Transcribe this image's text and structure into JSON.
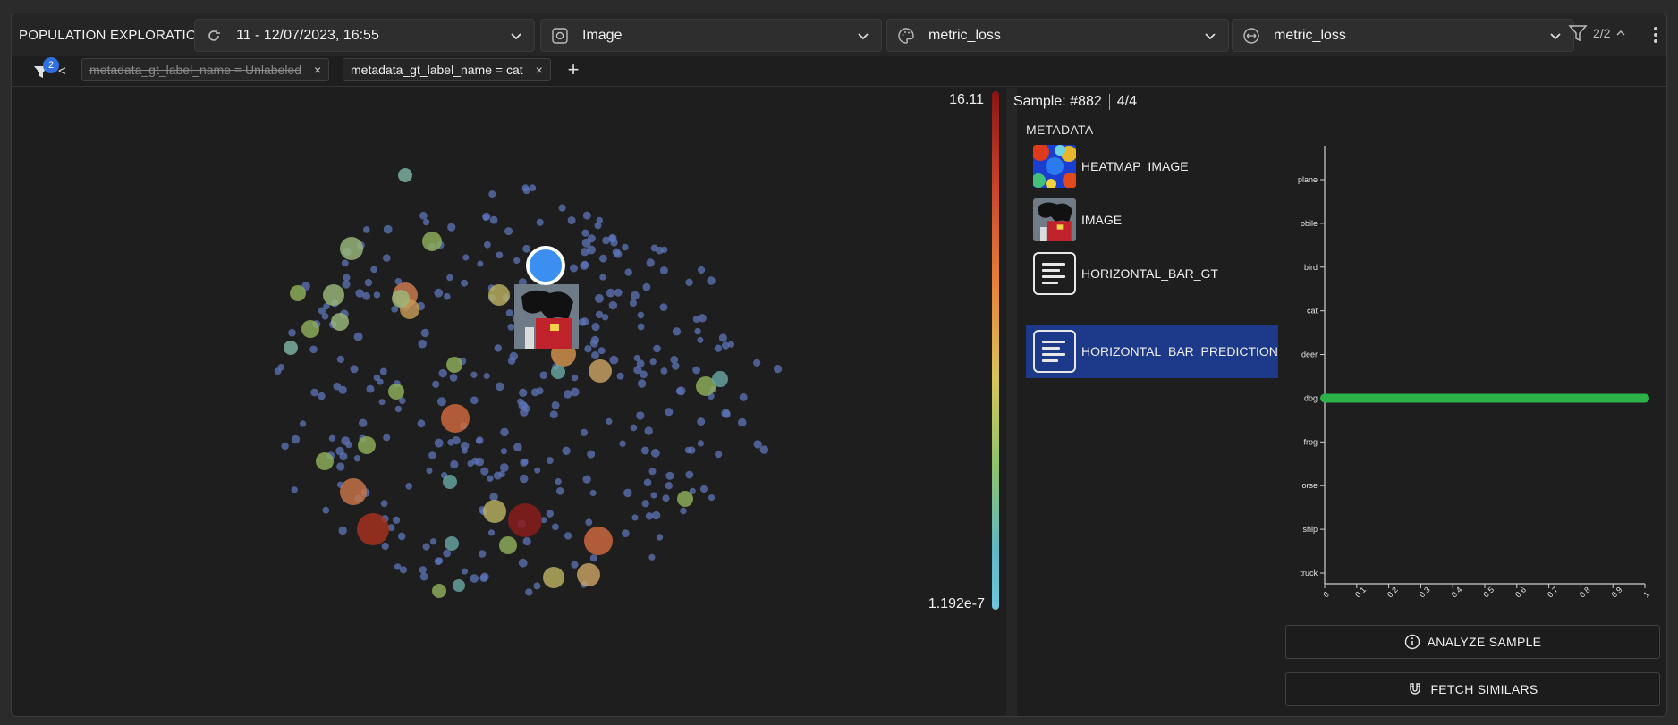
{
  "header": {
    "title": "POPULATION EXPLORATION",
    "version_selector": {
      "label": "11 - 12/07/2023, 16:55",
      "icon": "refresh-icon"
    },
    "visualization_selector": {
      "label": "Image",
      "icon": "gear-image-icon"
    },
    "color_selector": {
      "label": "metric_loss",
      "icon": "palette-icon"
    },
    "size_selector": {
      "label": "metric_loss",
      "icon": "size-icon"
    },
    "filter_count": "2/2"
  },
  "filters": {
    "badge_count": "2",
    "collapse_label": "<",
    "chips": [
      {
        "label": "metadata_gt_label_name = Unlabeled",
        "enabled": false,
        "close": "×"
      },
      {
        "label": "metadata_gt_label_name = cat",
        "enabled": true,
        "close": "×"
      }
    ],
    "add_label": "+"
  },
  "color_scale": {
    "max": "16.11",
    "min": "1.192e-7"
  },
  "sample": {
    "label": "Sample: #882",
    "position": "4/4",
    "metadata_title": "METADATA",
    "items": [
      {
        "label": "HEATMAP_IMAGE",
        "kind": "heatmap",
        "selected": false
      },
      {
        "label": "IMAGE",
        "kind": "image",
        "selected": false
      },
      {
        "label": "HORIZONTAL_BAR_GT",
        "kind": "doc",
        "selected": false
      },
      {
        "label": "HORIZONTAL_BAR_PREDICTION",
        "kind": "doc",
        "selected": true
      }
    ]
  },
  "chart_data": {
    "type": "bar",
    "orientation": "horizontal",
    "categories": [
      "airplane",
      "automobile",
      "bird",
      "cat",
      "deer",
      "dog",
      "frog",
      "horse",
      "ship",
      "truck"
    ],
    "category_tick_labels": [
      "plane",
      "obile",
      "bird",
      "cat",
      "deer",
      "dog",
      "frog",
      "orse",
      "ship",
      "truck"
    ],
    "values": [
      0,
      0,
      0,
      0,
      0,
      1,
      0,
      0,
      0,
      0
    ],
    "xlim": [
      0,
      1
    ],
    "x_ticks": [
      "0",
      "0.1",
      "0.2",
      "0.3",
      "0.4",
      "0.5",
      "0.6",
      "0.7",
      "0.8",
      "0.9",
      "1"
    ],
    "bar_color": "#2bb34a"
  },
  "actions": {
    "analyze_label": "ANALYZE SAMPLE",
    "fetch_label": "FETCH SIMILARS"
  },
  "colors": {
    "accent": "#3b8ff0",
    "selected_bg": "#1d3a8a",
    "badge": "#2f6fe0"
  }
}
